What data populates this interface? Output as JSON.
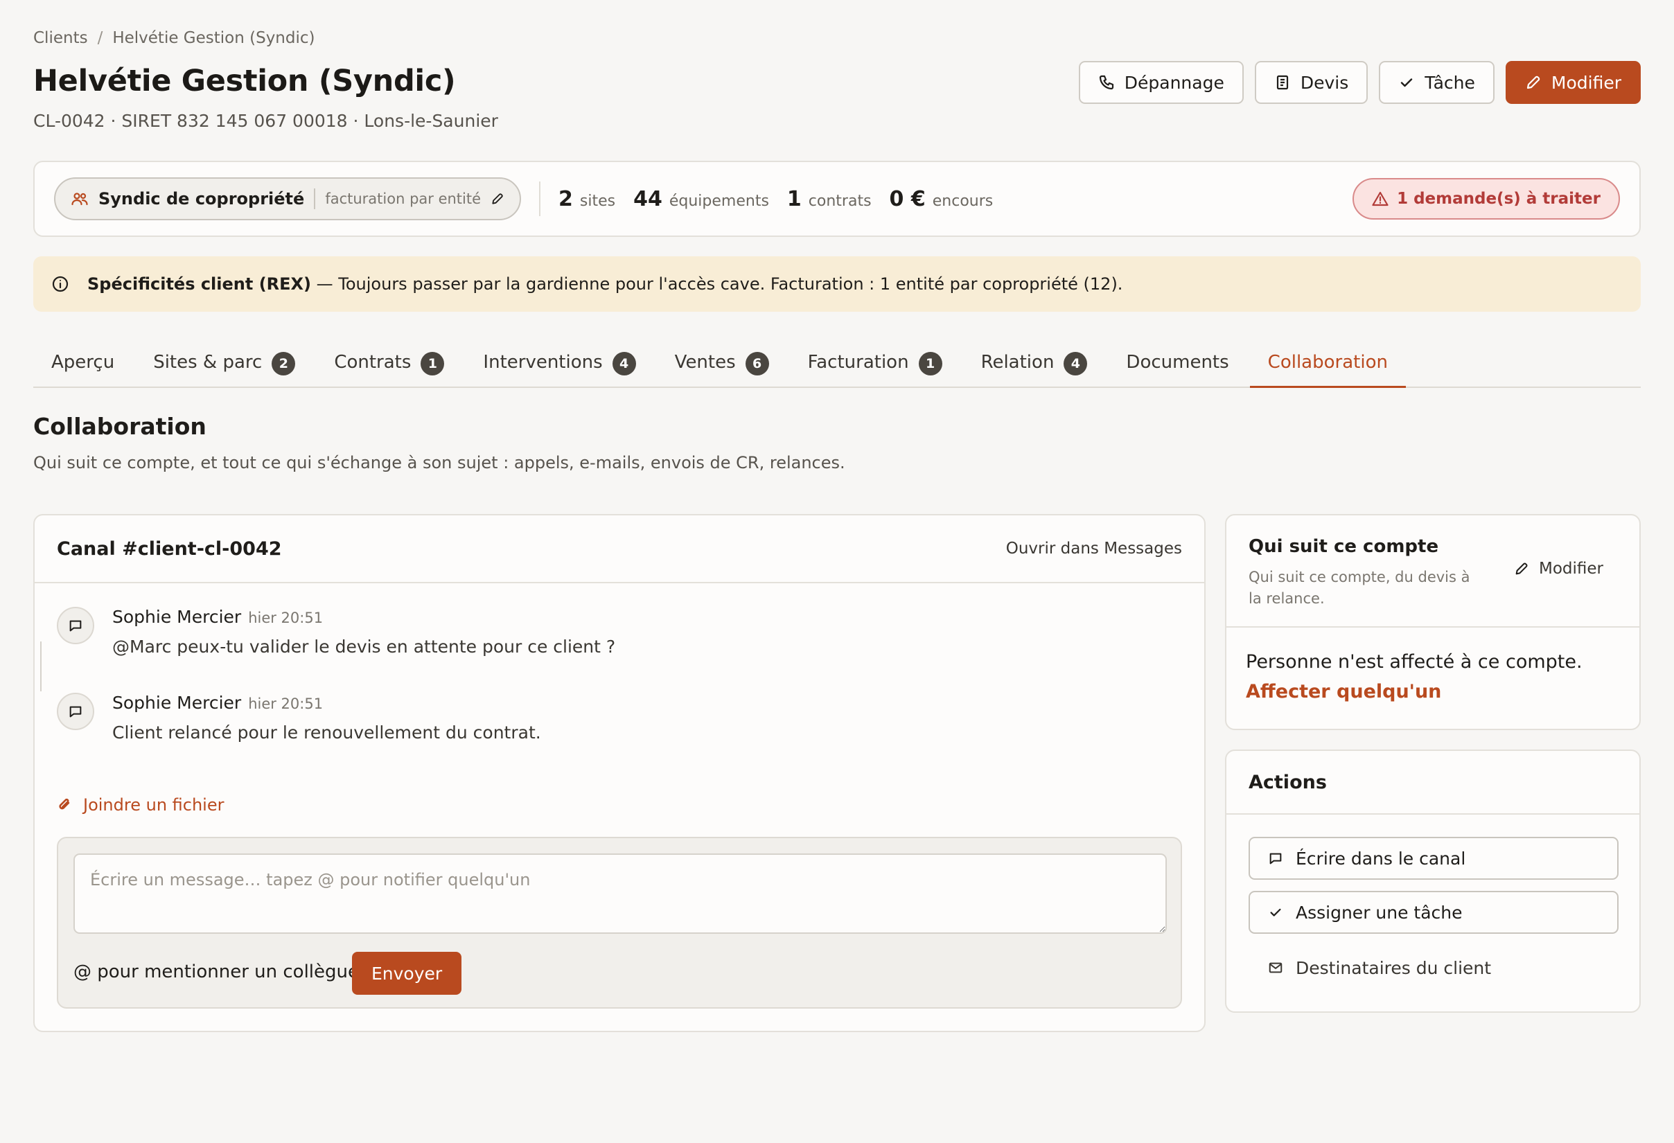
{
  "breadcrumb": {
    "root": "Clients",
    "separator": "/",
    "current": "Helvétie Gestion (Syndic)"
  },
  "header": {
    "title": "Helvétie Gestion (Syndic)",
    "subtitle": "CL-0042 · SIRET 832 145 067 00018 · Lons-le-Saunier",
    "buttons": {
      "depannage": "Dépannage",
      "devis": "Devis",
      "tache": "Tâche",
      "modifier": "Modifier"
    }
  },
  "stats": {
    "client_type": "Syndic de copropriété",
    "billing_mode": "facturation par entité",
    "sites_num": "2",
    "sites_label": "sites",
    "equip_num": "44",
    "equip_label": "équipements",
    "contracts_num": "1",
    "contracts_label": "contrats",
    "encours_num": "0 €",
    "encours_label": "encours",
    "alert": "1 demande(s) à traiter"
  },
  "notice": {
    "title": "Spécificités client (REX)",
    "text": " — Toujours passer par la gardienne pour l'accès cave. Facturation : 1 entité par copropriété (12)."
  },
  "tabs": [
    {
      "label": "Aperçu",
      "badge": ""
    },
    {
      "label": "Sites & parc",
      "badge": "2"
    },
    {
      "label": "Contrats",
      "badge": "1"
    },
    {
      "label": "Interventions",
      "badge": "4"
    },
    {
      "label": "Ventes",
      "badge": "6"
    },
    {
      "label": "Facturation",
      "badge": "1"
    },
    {
      "label": "Relation",
      "badge": "4"
    },
    {
      "label": "Documents",
      "badge": ""
    },
    {
      "label": "Collaboration",
      "badge": ""
    }
  ],
  "section": {
    "title": "Collaboration",
    "description": "Qui suit ce compte, et tout ce qui s'échange à son sujet : appels, e-mails, envois de CR, relances."
  },
  "channel": {
    "title": "Canal #client-cl-0042",
    "open_link": "Ouvrir dans Messages",
    "messages": [
      {
        "author": "Sophie Mercier",
        "time": "hier 20:51",
        "text": "@Marc peux-tu valider le devis en attente pour ce client ?"
      },
      {
        "author": "Sophie Mercier",
        "time": "hier 20:51",
        "text": "Client relancé pour le renouvellement du contrat."
      }
    ],
    "attach_label": "Joindre un fichier",
    "composer_placeholder": "Écrire un message… tapez @ pour notifier quelqu'un",
    "composer_value": "",
    "mention_hint": "@ pour mentionner un collègue",
    "send_label": "Envoyer"
  },
  "follow": {
    "title": "Qui suit ce compte",
    "description": "Qui suit ce compte, du devis à la relance.",
    "edit_label": "Modifier",
    "empty_text": "Personne n'est affecté à ce compte.",
    "assign_link": "Affecter quelqu'un"
  },
  "actions": {
    "title": "Actions",
    "write": "Écrire dans le canal",
    "assign": "Assigner une tâche",
    "recipients": "Destinataires du client"
  },
  "colors": {
    "accent": "#b94a1f",
    "alert": "#b23b38",
    "notice_bg": "#f8edd6",
    "badge": "#4a4640"
  },
  "icons": [
    "phone-icon",
    "document-icon",
    "check-icon",
    "pencil-icon",
    "people-icon",
    "warning-icon",
    "info-icon",
    "chat-icon",
    "paperclip-icon",
    "mail-icon"
  ]
}
